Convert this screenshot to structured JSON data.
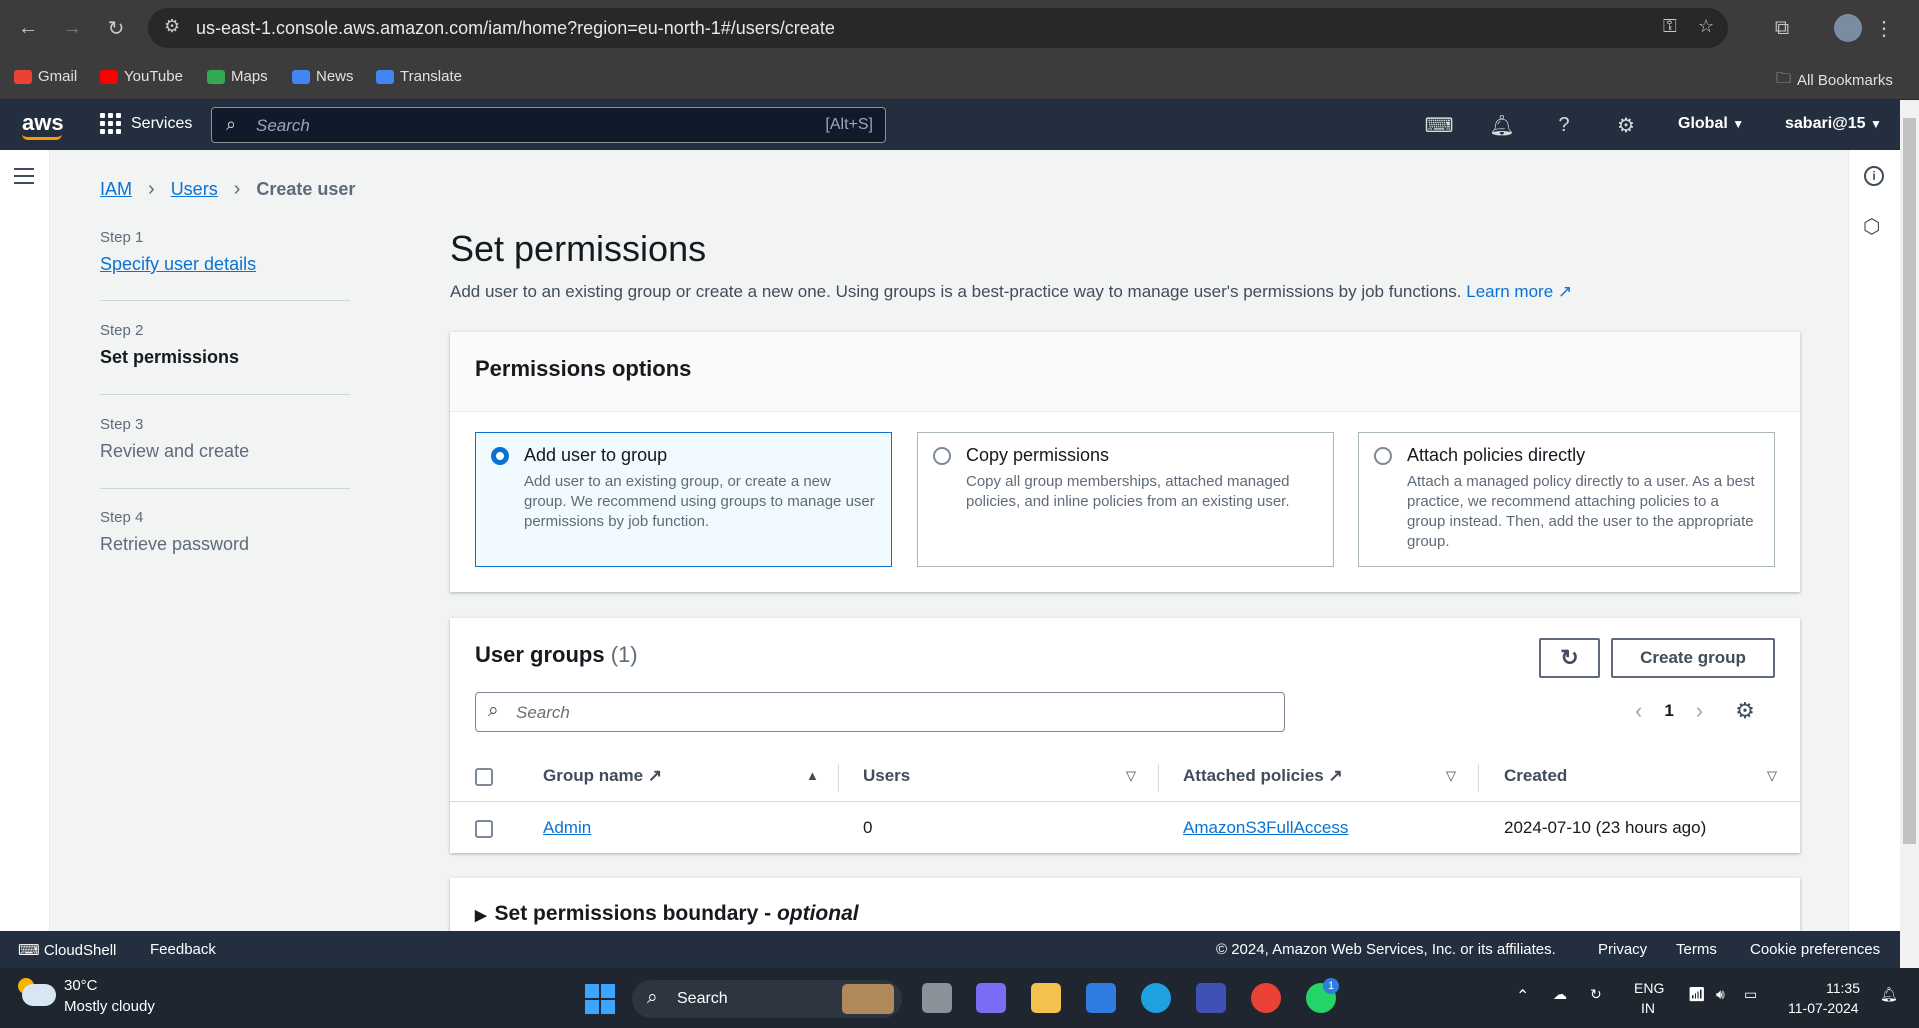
{
  "browser": {
    "url": "us-east-1.console.aws.amazon.com/iam/home?region=eu-north-1#/users/create",
    "bookmarks": [
      "Gmail",
      "YouTube",
      "Maps",
      "News",
      "Translate"
    ],
    "all_bookmarks": "All Bookmarks"
  },
  "aws_nav": {
    "logo": "aws",
    "services": "Services",
    "search_placeholder": "Search",
    "search_shortcut": "[Alt+S]",
    "region": "Global",
    "account": "sabari@15"
  },
  "breadcrumb": [
    "IAM",
    "Users",
    "Create user"
  ],
  "steps": [
    {
      "label": "Step 1",
      "title": "Specify user details"
    },
    {
      "label": "Step 2",
      "title": "Set permissions"
    },
    {
      "label": "Step 3",
      "title": "Review and create"
    },
    {
      "label": "Step 4",
      "title": "Retrieve password"
    }
  ],
  "page": {
    "title": "Set permissions",
    "description": "Add user to an existing group or create a new one. Using groups is a best-practice way to manage user's permissions by job functions.",
    "learn_more": "Learn more"
  },
  "permissions_options": {
    "title": "Permissions options",
    "options": [
      {
        "title": "Add user to group",
        "desc": "Add user to an existing group, or create a new group. We recommend using groups to manage user permissions by job function.",
        "selected": true
      },
      {
        "title": "Copy permissions",
        "desc": "Copy all group memberships, attached managed policies, and inline policies from an existing user.",
        "selected": false
      },
      {
        "title": "Attach policies directly",
        "desc": "Attach a managed policy directly to a user. As a best practice, we recommend attaching policies to a group instead. Then, add the user to the appropriate group.",
        "selected": false
      }
    ]
  },
  "user_groups": {
    "title": "User groups",
    "count": "(1)",
    "create_group": "Create group",
    "search_placeholder": "Search",
    "page": "1",
    "columns": [
      "Group name",
      "Users",
      "Attached policies",
      "Created"
    ],
    "rows": [
      {
        "group_name": "Admin",
        "users": "0",
        "policies": "AmazonS3FullAccess",
        "created": "2024-07-10 (23 hours ago)"
      }
    ]
  },
  "boundary": {
    "title": "Set permissions boundary - ",
    "optional": "optional"
  },
  "footer": {
    "cloudshell": "CloudShell",
    "feedback": "Feedback",
    "copyright": "© 2024, Amazon Web Services, Inc. or its affiliates.",
    "privacy": "Privacy",
    "terms": "Terms",
    "cookies": "Cookie preferences"
  },
  "taskbar": {
    "temp": "30°C",
    "weather": "Mostly cloudy",
    "search": "Search",
    "lang1": "ENG",
    "lang2": "IN",
    "time": "11:35",
    "date": "11-07-2024",
    "whatsapp_badge": "1"
  },
  "colors": {
    "aws_nav": "#232f3e",
    "link": "#0972d3",
    "accent": "#ff9900"
  }
}
